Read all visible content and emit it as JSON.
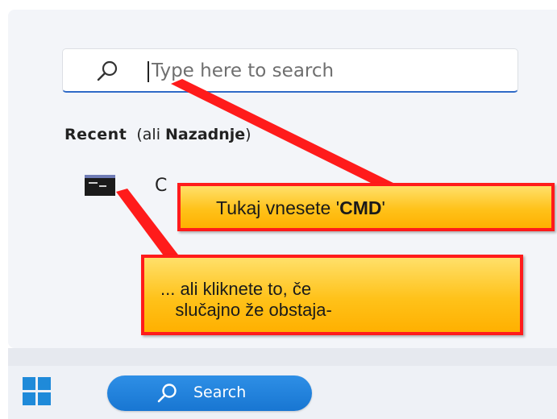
{
  "search": {
    "placeholder": "Type here to search",
    "icon": "search-icon"
  },
  "recent": {
    "title": "Recent",
    "note_prefix": "(ali ",
    "note_bold": "Nazadnje",
    "note_suffix": ")",
    "items": [
      {
        "label": "C",
        "icon": "command-prompt-icon"
      }
    ]
  },
  "taskbar": {
    "start_icon": "windows-logo-icon",
    "search_label": "Search",
    "search_icon": "search-icon"
  },
  "annotations": {
    "callout_1_text": "Tukaj vnesete '",
    "callout_1_bold": "CMD",
    "callout_1_end": "'",
    "callout_2_line1": "... ali kliknete to, če",
    "callout_2_line2": "   slučajno že obstaja-",
    "callout_color": "#ffc21a",
    "border_color": "#ff1b1b"
  },
  "colors": {
    "accent": "#2f6ac7",
    "taskbar_search": "#1876d2",
    "windows_blue": "#1f8ad9"
  }
}
